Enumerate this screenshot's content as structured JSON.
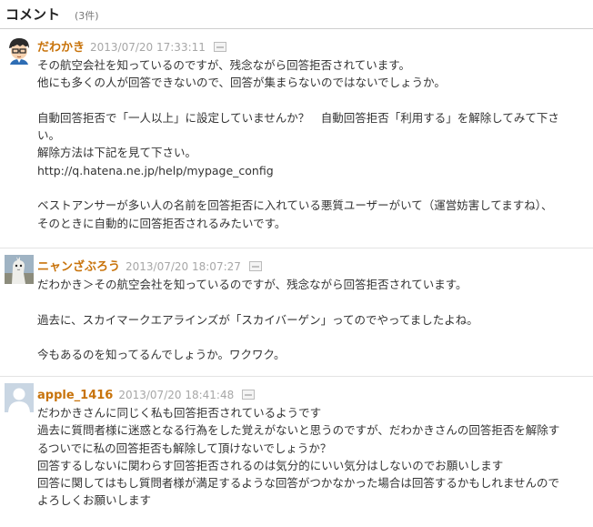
{
  "section": {
    "title": "コメント",
    "count": "(3件)"
  },
  "comments": [
    {
      "author": "だわかき",
      "timestamp": "2013/07/20 17:33:11",
      "lines": [
        "その航空会社を知っているのですが、残念ながら回答拒否されています。",
        "他にも多くの人が回答できないので、回答が集まらないのではないでしょうか。",
        "",
        "自動回答拒否で「一人以上」に設定していませんか？　自動回答拒否「利用する」を解除してみて下さ",
        "い。",
        "解除方法は下記を見て下さい。",
        "http://q.hatena.ne.jp/help/mypage_config",
        "",
        "ベストアンサーが多い人の名前を回答拒否に入れている悪質ユーザーがいて（運営妨害してますね）、",
        "そのときに自動的に回答拒否されるみたいです。"
      ]
    },
    {
      "author": "ニャンざぶろう",
      "timestamp": "2013/07/20 18:07:27",
      "lines": [
        "だわかき＞その航空会社を知っているのですが、残念ながら回答拒否されています。",
        "",
        "過去に、スカイマークエアラインズが「スカイバーゲン」ってのでやってましたよね。",
        "",
        "今もあるのを知ってるんでしょうか。ワクワク。"
      ]
    },
    {
      "author": "apple_1416",
      "timestamp": "2013/07/20 18:41:48",
      "lines": [
        "だわかきさんに同じく私も回答拒否されているようです",
        "過去に質問者様に迷惑となる行為をした覚えがないと思うのですが、だわかきさんの回答拒否を解除す",
        "るついでに私の回答拒否も解除して頂けないでしょうか？",
        "回答するしないに関わらす回答拒否されるのは気分的にいい気分はしないのでお願いします",
        "回答に関してはもし質問者様が満足するような回答がつかなかった場合は回答するかもしれませんので",
        "よろしくお願いします"
      ]
    }
  ]
}
